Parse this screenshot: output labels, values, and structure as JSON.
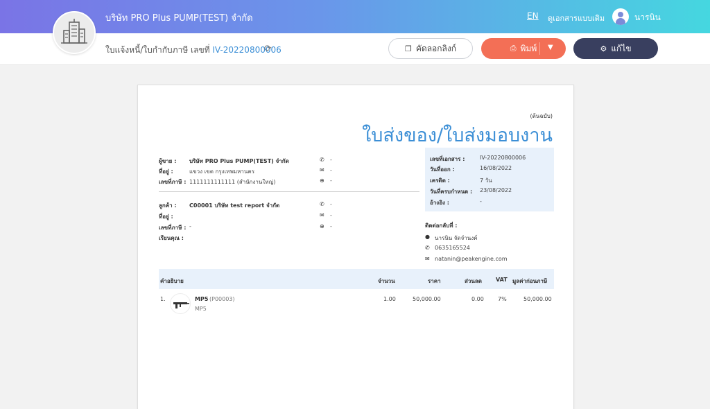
{
  "header": {
    "company": "บริษัท PRO Plus PUMP(TEST) จำกัด",
    "lang": "EN",
    "classic_view": "ดูเอกสารแบบเดิม",
    "user_name": "นารนิน"
  },
  "subbar": {
    "doc_title_prefix": "ใบแจ้งหนี้/ใบกำกับภาษี เลขที่",
    "doc_number": "IV-20220800006",
    "copy_link": "คัดลอกลิงก์",
    "print": "พิมพ์",
    "edit": "แก้ไข"
  },
  "document": {
    "original_label": "(ต้นฉบับ)",
    "title": "ใบส่งของ/ใบส่งมอบงาน",
    "seller": {
      "seller_label": "ผู้ขาย :",
      "seller_value": "บริษัท PRO Plus PUMP(TEST) จำกัด",
      "address_label": "ที่อยู่ :",
      "address_value": "แขวง เขต กรุงเทพมหานคร",
      "tax_label": "เลขที่ภาษี :",
      "tax_value": "1111111111111 (สำนักงานใหญ่)",
      "phone": "-",
      "email": "-",
      "web": "-"
    },
    "customer": {
      "customer_label": "ลูกค้า :",
      "customer_value": "C00001 บริษัท test report จำกัด",
      "address_label": "ที่อยู่ :",
      "tax_label": "เลขที่ภาษี :",
      "tax_value": "-",
      "attention_label": "เรียนคุณ :",
      "phone": "-",
      "email": "-",
      "web": "-"
    },
    "info": {
      "doc_no_label": "เลขที่เอกสาร :",
      "doc_no_value": "IV-20220800006",
      "issue_label": "วันที่ออก :",
      "issue_value": "16/08/2022",
      "credit_label": "เครดิต :",
      "credit_value": "7 วัน",
      "due_label": "วันที่ครบกำหนด :",
      "due_value": "23/08/2022",
      "ref_label": "อ้างอิง :",
      "ref_value": "-"
    },
    "contact": {
      "label": "ติดต่อกลับที่ :",
      "name": "นารนิน จัดจำนงค์",
      "phone": "0635165524",
      "email": "natanin@peakengine.com"
    },
    "table": {
      "headers": {
        "description": "คำอธิบาย",
        "qty": "จำนวน",
        "price": "ราคา",
        "discount": "ส่วนลด",
        "vat": "VAT",
        "amount": "มูลค่าก่อนภาษี"
      },
      "rows": [
        {
          "no": "1.",
          "name": "MP5",
          "code": "(P00003)",
          "desc": "MP5",
          "qty": "1.00",
          "price": "50,000.00",
          "discount": "0.00",
          "vat": "7%",
          "amount": "50,000.00"
        }
      ]
    }
  }
}
